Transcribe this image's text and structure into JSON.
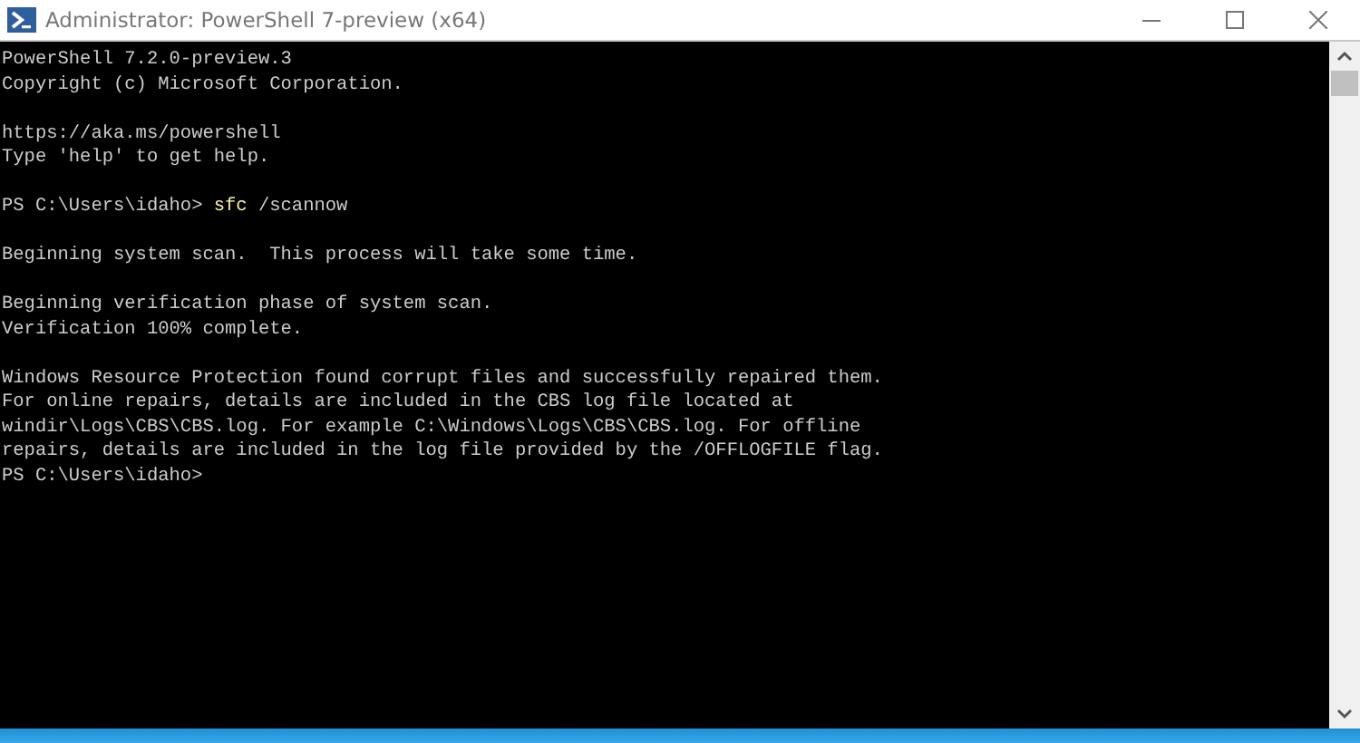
{
  "window": {
    "title": "Administrator: PowerShell 7-preview (x64)"
  },
  "console": {
    "blocks": [
      {
        "lines": [
          {
            "kind": "output",
            "text": "PowerShell 7.2.0-preview.3"
          },
          {
            "kind": "output",
            "text": "Copyright (c) Microsoft Corporation."
          }
        ]
      },
      {
        "lines": [
          {
            "kind": "output",
            "text": "https://aka.ms/powershell"
          },
          {
            "kind": "output",
            "text": "Type 'help' to get help."
          }
        ]
      },
      {
        "lines": [
          {
            "kind": "prompt",
            "prompt": "PS C:\\Users\\idaho>",
            "command": "sfc",
            "args": "/scannow"
          }
        ]
      },
      {
        "lines": [
          {
            "kind": "output",
            "text": "Beginning system scan.  This process will take some time."
          }
        ]
      },
      {
        "lines": [
          {
            "kind": "output",
            "text": "Beginning verification phase of system scan."
          },
          {
            "kind": "output",
            "text": "Verification 100% complete."
          }
        ]
      },
      {
        "lines": [
          {
            "kind": "output",
            "text": "Windows Resource Protection found corrupt files and successfully repaired them."
          },
          {
            "kind": "output",
            "text": "For online repairs, details are included in the CBS log file located at"
          },
          {
            "kind": "output",
            "text": "windir\\Logs\\CBS\\CBS.log. For example C:\\Windows\\Logs\\CBS\\CBS.log. For offline"
          },
          {
            "kind": "output",
            "text": "repairs, details are included in the log file provided by the /OFFLOGFILE flag."
          },
          {
            "kind": "prompt",
            "prompt": "PS C:\\Users\\idaho>"
          }
        ]
      }
    ]
  }
}
